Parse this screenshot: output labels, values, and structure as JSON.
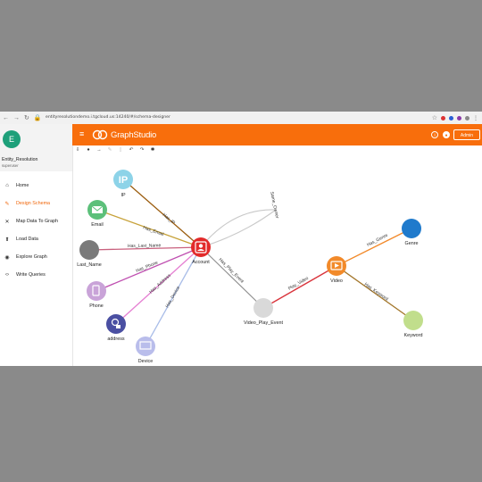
{
  "browser": {
    "url": "entityresolutiondemo.i.tgcloud.us:14240/#/schema-designer",
    "nav_icons": [
      "back-icon",
      "forward-icon",
      "reload-icon",
      "lock-icon"
    ]
  },
  "sidebar": {
    "avatar_letter": "E",
    "user_name": "Entity_Resolution",
    "user_role": "superuser",
    "items": [
      {
        "label": "Home",
        "icon": "home-icon"
      },
      {
        "label": "Design Schema",
        "icon": "pencil-icon",
        "active": true
      },
      {
        "label": "Map Data To Graph",
        "icon": "shuffle-icon"
      },
      {
        "label": "Load Data",
        "icon": "load-icon"
      },
      {
        "label": "Explore Graph",
        "icon": "compass-icon"
      },
      {
        "label": "Write Queries",
        "icon": "code-icon"
      }
    ]
  },
  "header": {
    "brand": "GraphStudio",
    "admin_label": "Admin",
    "accent": "#f86e0c"
  },
  "toolbar": {
    "icons": [
      "publish-icon",
      "add-vertex-icon",
      "add-edge-icon",
      "edit-icon",
      "delete-icon",
      "undo-icon",
      "redo-icon",
      "settings-icon"
    ]
  },
  "graph": {
    "vertices": [
      {
        "id": "IP",
        "label": "IP",
        "inner": "IP",
        "color": "#8dd3e8"
      },
      {
        "id": "Email",
        "label": "Email",
        "color": "#5cc07a"
      },
      {
        "id": "Last_Name",
        "label": "Last_Name",
        "color": "#7a7a7a"
      },
      {
        "id": "Phone",
        "label": "Phone",
        "color": "#c9a3d8"
      },
      {
        "id": "address",
        "label": "address",
        "color": "#4a4fa2"
      },
      {
        "id": "Device",
        "label": "Device",
        "color": "#b9bdeb"
      },
      {
        "id": "Account",
        "label": "Account",
        "color": "#e22a2a"
      },
      {
        "id": "Video_Play_Event",
        "label": "Video_Play_Event",
        "color": "#d9d9d9"
      },
      {
        "id": "Video",
        "label": "Video",
        "color": "#f28a2a"
      },
      {
        "id": "Genre",
        "label": "Genre",
        "color": "#1f7acc"
      },
      {
        "id": "Keyword",
        "label": "Keyword",
        "color": "#c1de8c"
      }
    ],
    "edges": [
      {
        "label": "Has_IP",
        "color": "#9b5d0f"
      },
      {
        "label": "Has_Email",
        "color": "#c7a23a"
      },
      {
        "label": "Has_Last_Name",
        "color": "#c9617e"
      },
      {
        "label": "Has_Phone",
        "color": "#bf4fb0"
      },
      {
        "label": "Has_Address",
        "color": "#e57fd2"
      },
      {
        "label": "Has_Device",
        "color": "#a9bde8"
      },
      {
        "label": "Same_Owner",
        "color": "#c9c9c9"
      },
      {
        "label": "Has_Play_Event",
        "color": "#8e8e8e"
      },
      {
        "label": "Play_Video",
        "color": "#d9343c"
      },
      {
        "label": "Has_Genre",
        "color": "#f28a2a"
      },
      {
        "label": "Has_Keyword",
        "color": "#a3762a"
      }
    ]
  }
}
